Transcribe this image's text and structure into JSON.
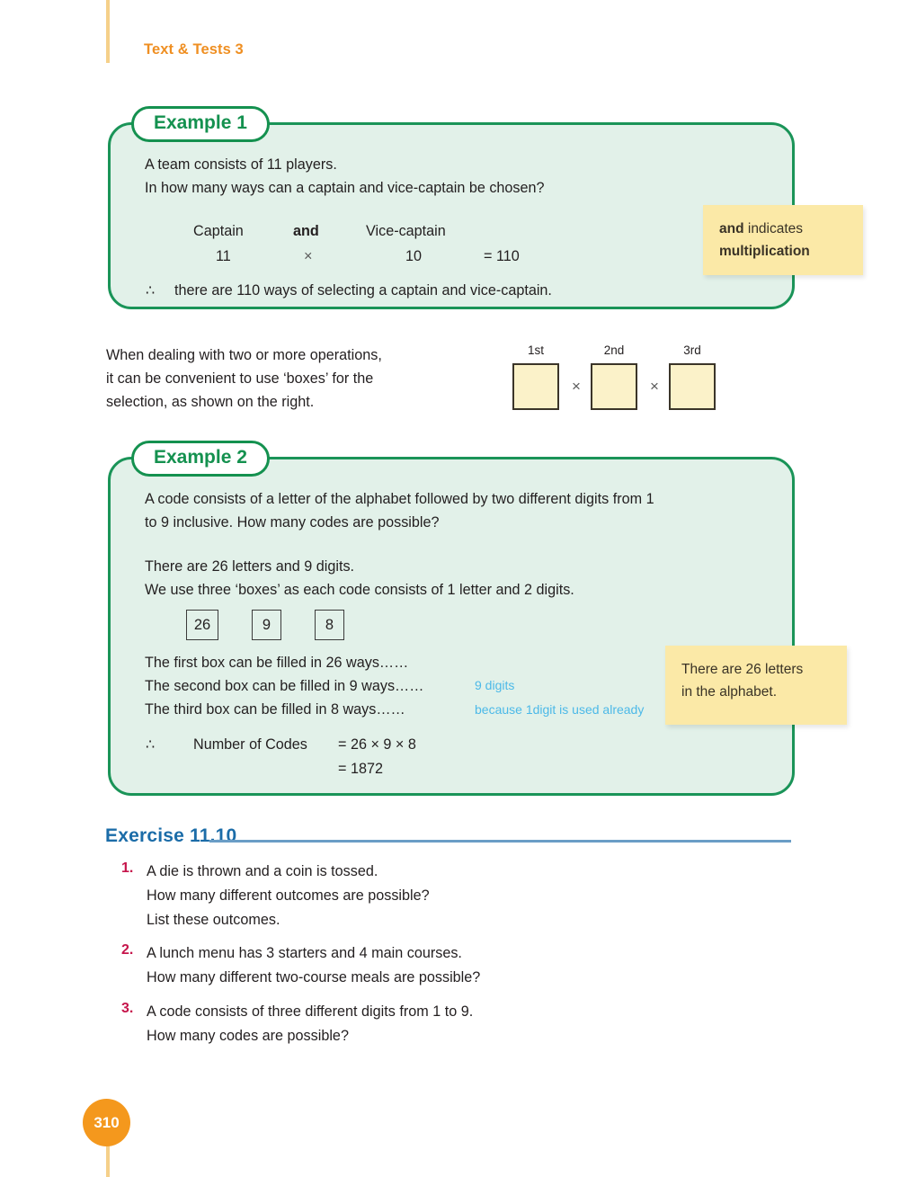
{
  "header": {
    "book_title": "Text & Tests 3"
  },
  "example1": {
    "tag": "Example 1",
    "line1": "A team consists of 11 players.",
    "line2": "In how many ways can a captain and vice-captain be chosen?",
    "table": {
      "col1_header": "Captain",
      "col2_header": "and",
      "col3_header": "Vice-captain",
      "col1_value": "11",
      "col2_value": "×",
      "col3_value": "10",
      "result": "= 110"
    },
    "therefore_symbol": "∴",
    "conclusion": "there are 110 ways of selecting a captain and vice-captain."
  },
  "callout1": {
    "bold_lead": "and",
    "rest": " indicates",
    "line2": "multiplication"
  },
  "intro": {
    "line1": "When dealing with two or more operations,",
    "line2": "it can be convenient to use ‘boxes’ for the",
    "line3": "selection, as shown on the right."
  },
  "boxdiagram": {
    "labels": [
      "1st",
      "2nd",
      "3rd"
    ],
    "operators": [
      "×",
      "×"
    ]
  },
  "example2": {
    "tag": "Example 2",
    "question_line1": "A code consists of a letter of the alphabet followed by two different digits from 1",
    "question_line2": "to 9 inclusive. How many codes are possible?",
    "fact_line1": "There are 26 letters and 9 digits.",
    "fact_line2": "We use three ‘boxes’ as each code consists of 1 letter and 2 digits.",
    "boxes": [
      "26",
      "9",
      "8"
    ],
    "ways_line1": "The first box can be filled in 26 ways……",
    "ways_line2": "The second box can be filled in 9 ways……",
    "ways_line3": "The third box can be filled in 8 ways……",
    "annot1": "9 digits",
    "annot2": "because 1digit is used already",
    "therefore_symbol": "∴",
    "result_label": "Number of Codes",
    "result_line1": "= 26 × 9 × 8",
    "result_line2": "= 1872"
  },
  "callout2": {
    "line1": "There are 26 letters",
    "line2": "in the alphabet."
  },
  "exercise": {
    "title": "Exercise 11.10",
    "questions": [
      {
        "number": "1.",
        "lines": [
          "A die is thrown and a coin is tossed.",
          "How many different outcomes are possible?",
          "List these outcomes."
        ]
      },
      {
        "number": "2.",
        "lines": [
          "A lunch menu has 3 starters and 4 main courses.",
          "How many different two-course meals are possible?"
        ]
      },
      {
        "number": "3.",
        "lines": [
          "A code consists of three different digits from 1 to 9.",
          "How many codes are possible?"
        ]
      }
    ]
  },
  "footer": {
    "page_number": "310"
  },
  "colors": {
    "brand_orange": "#ef8f22",
    "example_green_border": "#1a9458",
    "example_green_fill": "#e2f1e9",
    "callout_yellow": "#fbe9a7",
    "exercise_blue": "#1b6ca8",
    "annotation_blue": "#4cb9e8",
    "question_number_red": "#c6154b"
  }
}
